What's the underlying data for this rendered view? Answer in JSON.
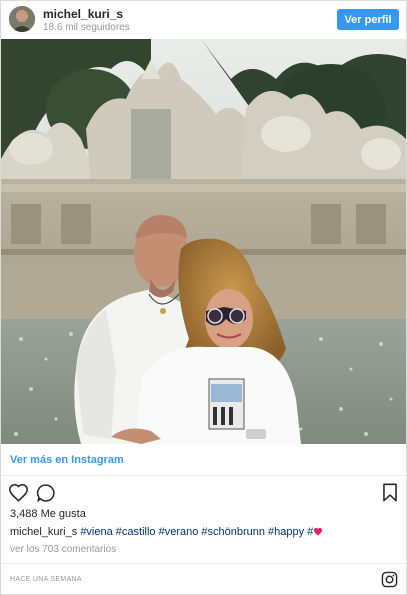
{
  "header": {
    "username": "michel_kuri_s",
    "followers": "18.6 mil seguidores",
    "view_profile_label": "Ver perfil"
  },
  "post": {
    "more_link": "Ver más en Instagram",
    "likes": "3,488 Me gusta",
    "caption_user": "michel_kuri_s",
    "caption_tags": "#viena #castillo #verano #schönbrunn #happy #",
    "comments_link": "ver los 703 comentarios",
    "timestamp": "HACE UNA SEMANA"
  },
  "icons": {
    "like": "heart-icon",
    "comment": "comment-icon",
    "save": "bookmark-icon",
    "brand": "instagram-icon",
    "caption_emoji": "red-heart-emoji"
  },
  "colors": {
    "accent": "#3897f0",
    "hashtag": "#003569",
    "muted": "#999999",
    "heart_emoji": "#e0245e"
  }
}
